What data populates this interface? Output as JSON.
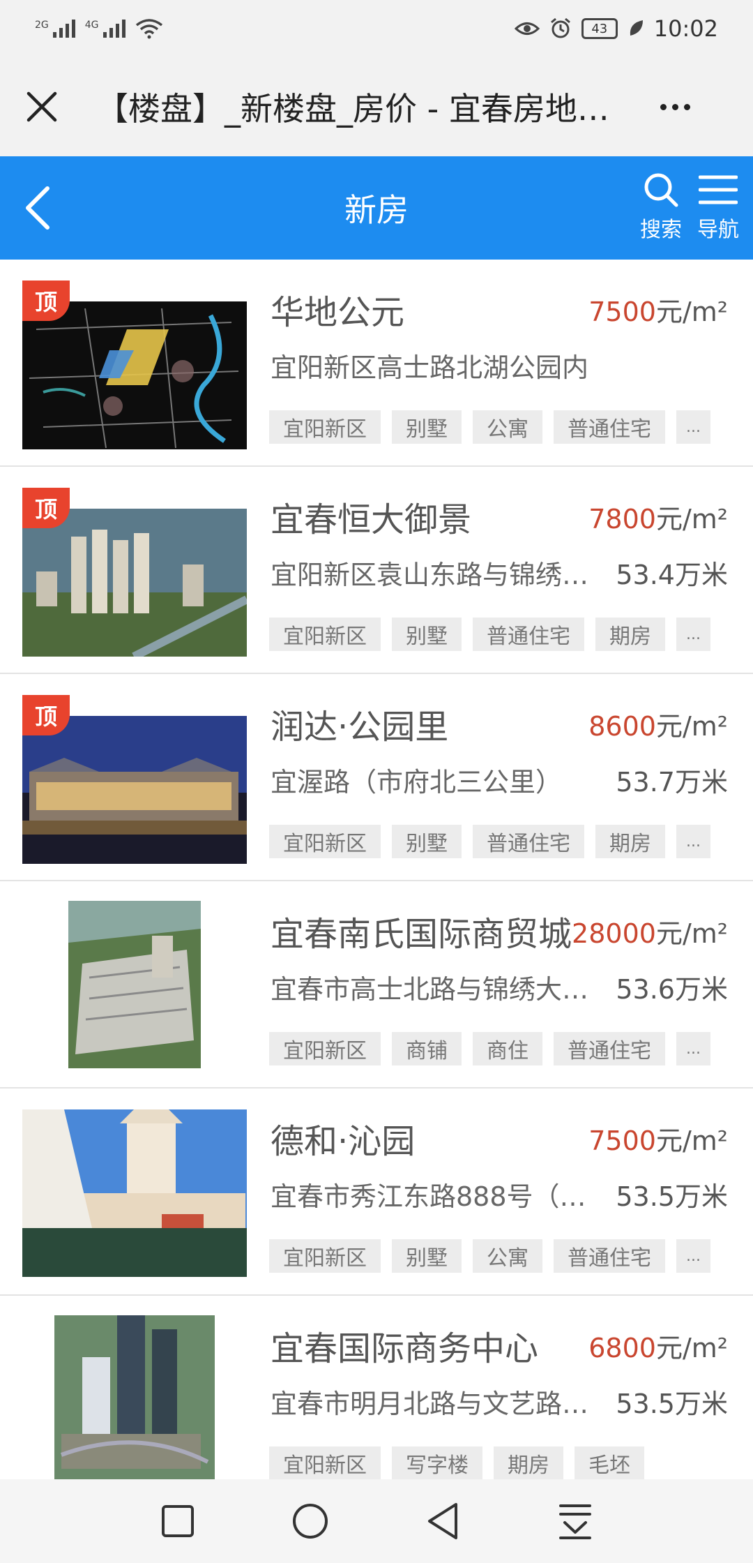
{
  "status_bar": {
    "signal1_label": "2G",
    "signal2_label": "4G",
    "battery": "43",
    "time": "10:02"
  },
  "browser": {
    "title": "【楼盘】_新楼盘_房价 - 宜春房地…"
  },
  "app_bar": {
    "title": "新房",
    "search_label": "搜索",
    "nav_label": "导航"
  },
  "listings": [
    {
      "name": "华地公元",
      "price": "7500",
      "price_unit": "元/m²",
      "address": "宜阳新区高士路北湖公园内",
      "distance": "",
      "top_badge": "顶",
      "tags": [
        "宜阳新区",
        "别墅",
        "公寓",
        "普通住宅",
        "..."
      ]
    },
    {
      "name": "宜春恒大御景",
      "price": "7800",
      "price_unit": "元/m²",
      "address": "宜阳新区袁山东路与锦绣…",
      "distance": "53.4万米",
      "top_badge": "顶",
      "tags": [
        "宜阳新区",
        "别墅",
        "普通住宅",
        "期房",
        "..."
      ]
    },
    {
      "name": "润达·公园里",
      "price": "8600",
      "price_unit": "元/m²",
      "address": "宜渥路（市府北三公里）",
      "distance": "53.7万米",
      "top_badge": "顶",
      "tags": [
        "宜阳新区",
        "别墅",
        "普通住宅",
        "期房",
        "..."
      ]
    },
    {
      "name": "宜春南氏国际商贸城",
      "price": "28000",
      "price_unit": "元/m²",
      "address": "宜春市高士北路与锦绣大…",
      "distance": "53.6万米",
      "top_badge": "",
      "tags": [
        "宜阳新区",
        "商铺",
        "商住",
        "普通住宅",
        "..."
      ]
    },
    {
      "name": "德和·沁园",
      "price": "7500",
      "price_unit": "元/m²",
      "address": "宜春市秀江东路888号（…",
      "distance": "53.5万米",
      "top_badge": "",
      "tags": [
        "宜阳新区",
        "别墅",
        "公寓",
        "普通住宅",
        "..."
      ]
    },
    {
      "name": "宜春国际商务中心",
      "price": "6800",
      "price_unit": "元/m²",
      "address": "宜春市明月北路与文艺路…",
      "distance": "53.5万米",
      "top_badge": "",
      "tags": [
        "宜阳新区",
        "写字楼",
        "期房",
        "毛坯"
      ]
    }
  ],
  "colors": {
    "app_bar": "#1d8cf0",
    "price": "#c9462f",
    "badge": "#e8432d"
  }
}
